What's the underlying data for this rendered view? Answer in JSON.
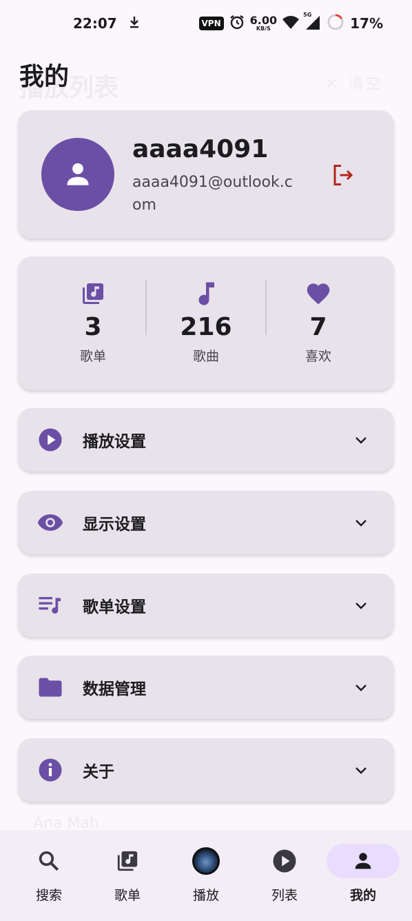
{
  "status_bar": {
    "time": "22:07",
    "vpn": "VPN",
    "net_speed_value": "6.00",
    "net_speed_unit": "KB/S",
    "signal_label": "5G",
    "battery": "17%",
    "battery_level": 0.17
  },
  "page": {
    "title": "我的",
    "ghost_title": "播放列表",
    "ghost_right": "✕ 清空"
  },
  "profile": {
    "username": "aaaa4091",
    "email": "aaaa4091@outlook.com"
  },
  "stats": [
    {
      "value": "3",
      "label": "歌单",
      "icon": "playlist-icon"
    },
    {
      "value": "216",
      "label": "歌曲",
      "icon": "music-note-icon"
    },
    {
      "value": "7",
      "label": "喜欢",
      "icon": "heart-icon"
    }
  ],
  "settings": [
    {
      "label": "播放设置",
      "icon": "play-circle-icon"
    },
    {
      "label": "显示设置",
      "icon": "eye-icon"
    },
    {
      "label": "歌单设置",
      "icon": "queue-music-icon"
    },
    {
      "label": "数据管理",
      "icon": "folder-icon"
    },
    {
      "label": "关于",
      "icon": "info-icon"
    }
  ],
  "ghost_under": "Ana Mah",
  "bottom_nav": [
    {
      "label": "搜索",
      "icon": "search-icon",
      "active": false
    },
    {
      "label": "歌单",
      "icon": "library-music-icon",
      "active": false
    },
    {
      "label": "播放",
      "icon": "album-disc-icon",
      "active": false
    },
    {
      "label": "列表",
      "icon": "play-list-icon",
      "active": false
    },
    {
      "label": "我的",
      "icon": "person-icon",
      "active": true
    }
  ],
  "colors": {
    "accent": "#6b4fa5",
    "logout": "#b3261e",
    "card": "#e8e2ea",
    "background": "#fcf7fc",
    "nav_active": "#e9ddff"
  }
}
